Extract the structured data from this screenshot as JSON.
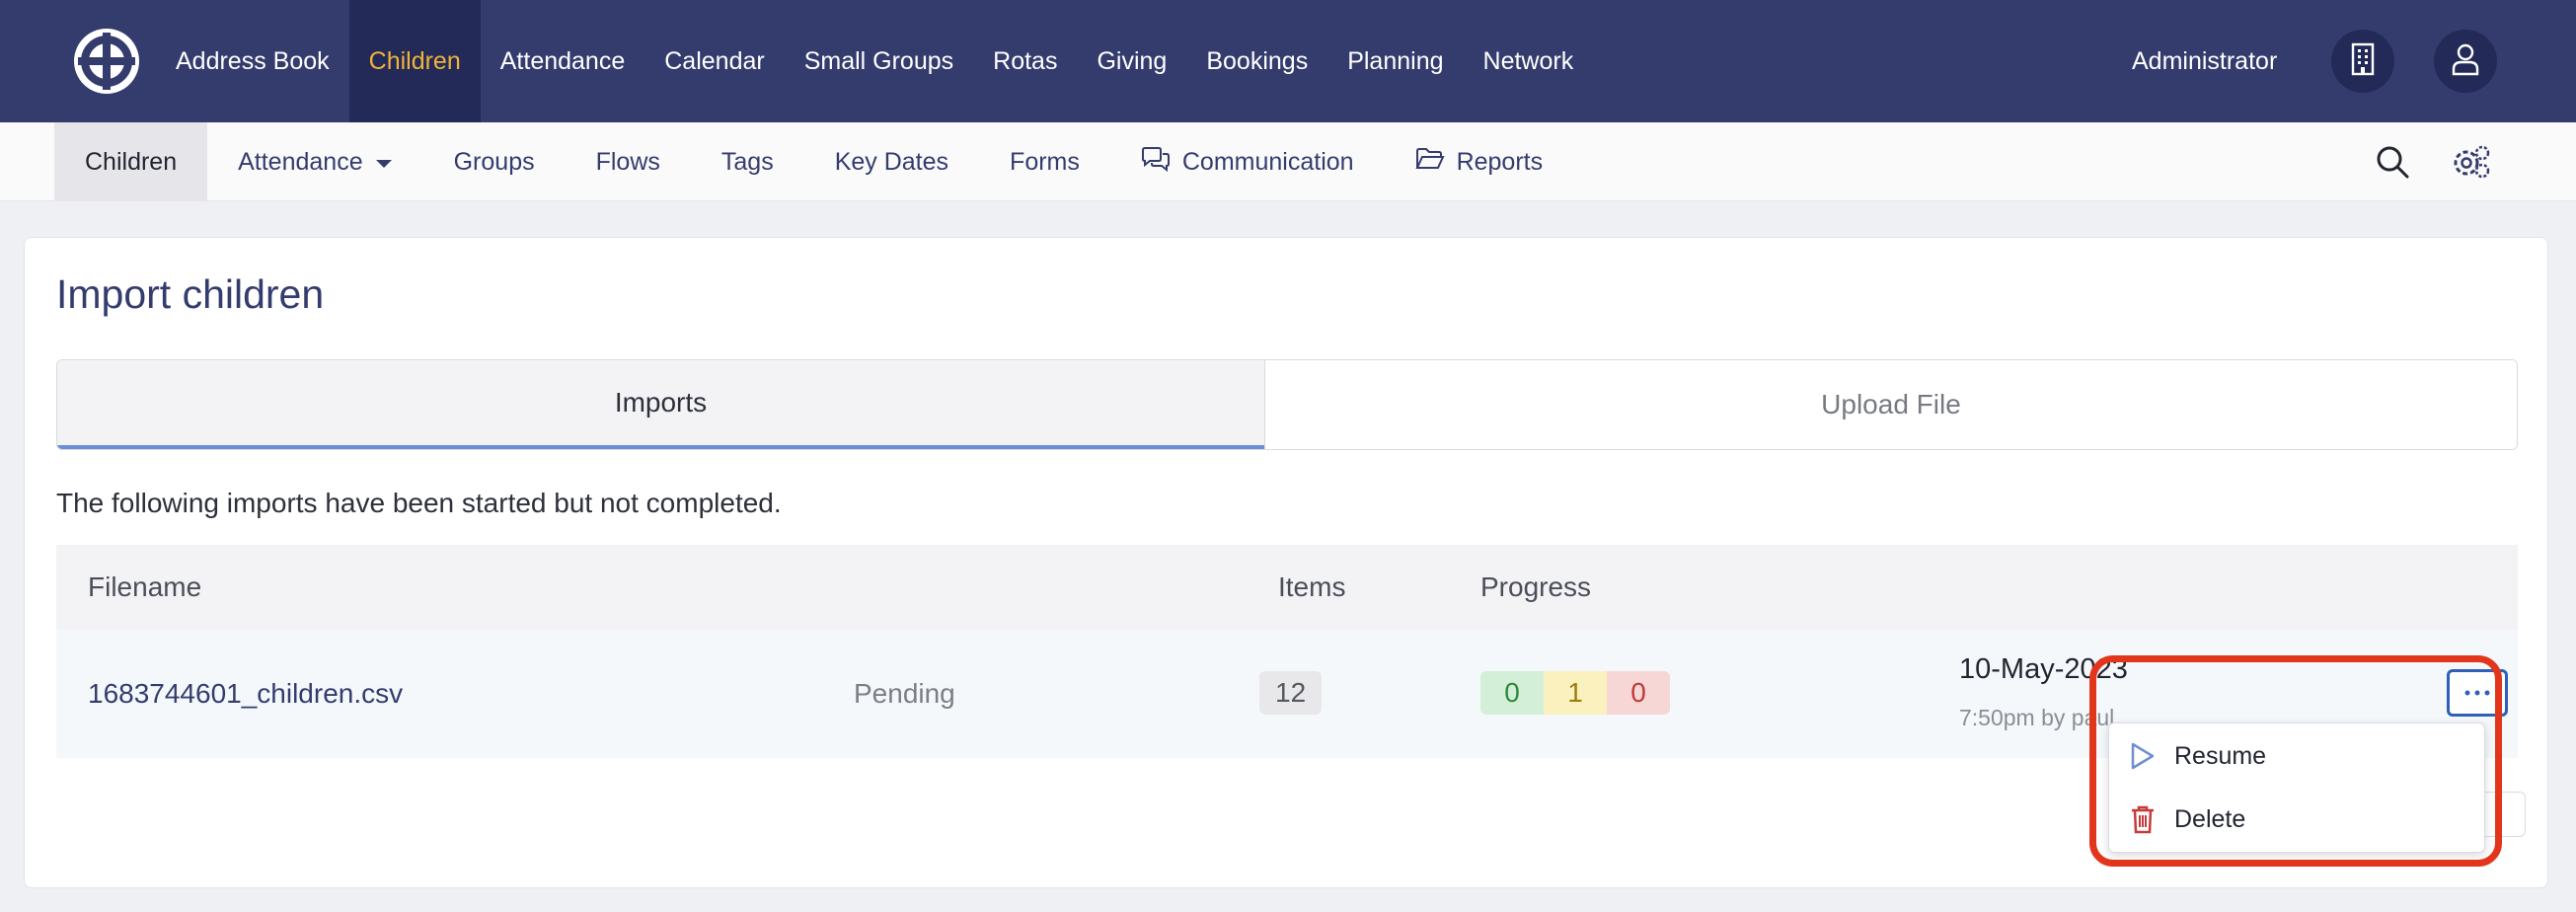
{
  "topnav": {
    "items": [
      {
        "label": "Address Book"
      },
      {
        "label": "Children",
        "active": true
      },
      {
        "label": "Attendance"
      },
      {
        "label": "Calendar"
      },
      {
        "label": "Small Groups"
      },
      {
        "label": "Rotas"
      },
      {
        "label": "Giving"
      },
      {
        "label": "Bookings"
      },
      {
        "label": "Planning"
      },
      {
        "label": "Network"
      }
    ],
    "user_label": "Administrator",
    "icons": [
      "building-icon",
      "user-icon"
    ]
  },
  "subnav": {
    "items": [
      {
        "label": "Children",
        "active": true
      },
      {
        "label": "Attendance",
        "icon": "caret-down-icon"
      },
      {
        "label": "Groups"
      },
      {
        "label": "Flows"
      },
      {
        "label": "Tags"
      },
      {
        "label": "Key Dates"
      },
      {
        "label": "Forms"
      },
      {
        "label": "Communication",
        "icon": "chat-bubbles-icon"
      },
      {
        "label": "Reports",
        "icon": "folder-icon"
      }
    ],
    "right_icons": [
      "search-icon",
      "settings-gears-icon"
    ]
  },
  "page": {
    "title": "Import children",
    "tabs": [
      {
        "label": "Imports",
        "active": true
      },
      {
        "label": "Upload File"
      }
    ],
    "intro": "The following imports have been started but not completed."
  },
  "table": {
    "headers": {
      "filename": "Filename",
      "items": "Items",
      "progress": "Progress"
    },
    "rows": [
      {
        "filename": "1683744601_children.csv",
        "status": "Pending",
        "items": "12",
        "progress": {
          "success": "0",
          "warning": "1",
          "error": "0"
        },
        "date": "10-May-2023",
        "time": "7:50pm by paul"
      }
    ]
  },
  "row_menu": {
    "items": [
      {
        "label": "Resume",
        "icon": "play-icon"
      },
      {
        "label": "Delete",
        "icon": "trash-icon"
      }
    ]
  },
  "colors": {
    "nav_bg": "#343c6e",
    "nav_active_bg": "#232a57",
    "nav_active_text": "#f0b33c",
    "highlight": "#e2361c"
  }
}
